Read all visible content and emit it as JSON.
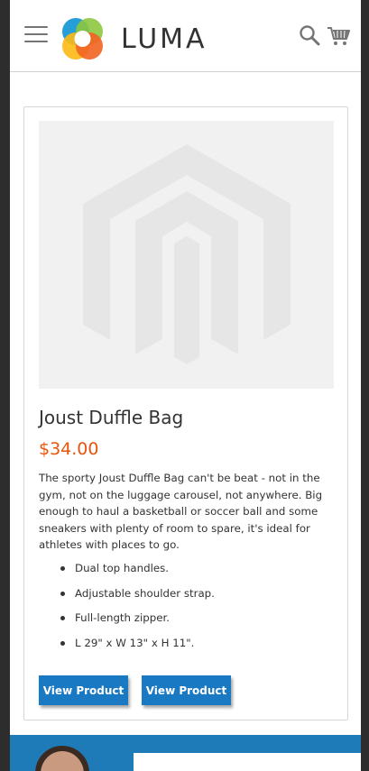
{
  "header": {
    "brand": "LUMA",
    "icons": {
      "menu": "hamburger-menu-icon",
      "search": "search-icon",
      "cart": "shopping-cart-icon"
    },
    "logo_colors": [
      "#1a9ad6",
      "#f26322",
      "#8dc63f",
      "#fdb913"
    ]
  },
  "product": {
    "name": "Joust Duffle Bag",
    "price": "$34.00",
    "price_color": "#e8540b",
    "description": "The sporty Joust Duffle Bag can't be beat - not in the gym, not on the luggage carousel, not anywhere. Big enough to haul a basketball or soccer ball and some sneakers with plenty of room to spare, it's ideal for athletes with places to go.",
    "features": [
      "Dual top handles.",
      "Adjustable shoulder strap.",
      "Full-length zipper.",
      "L 29\" x W 13\" x H 11\"."
    ],
    "image_placeholder_icon": "magento-logo-placeholder-icon"
  },
  "actions": {
    "button_1": "View Product",
    "button_2": "View Product",
    "accent": "#1979c3"
  }
}
